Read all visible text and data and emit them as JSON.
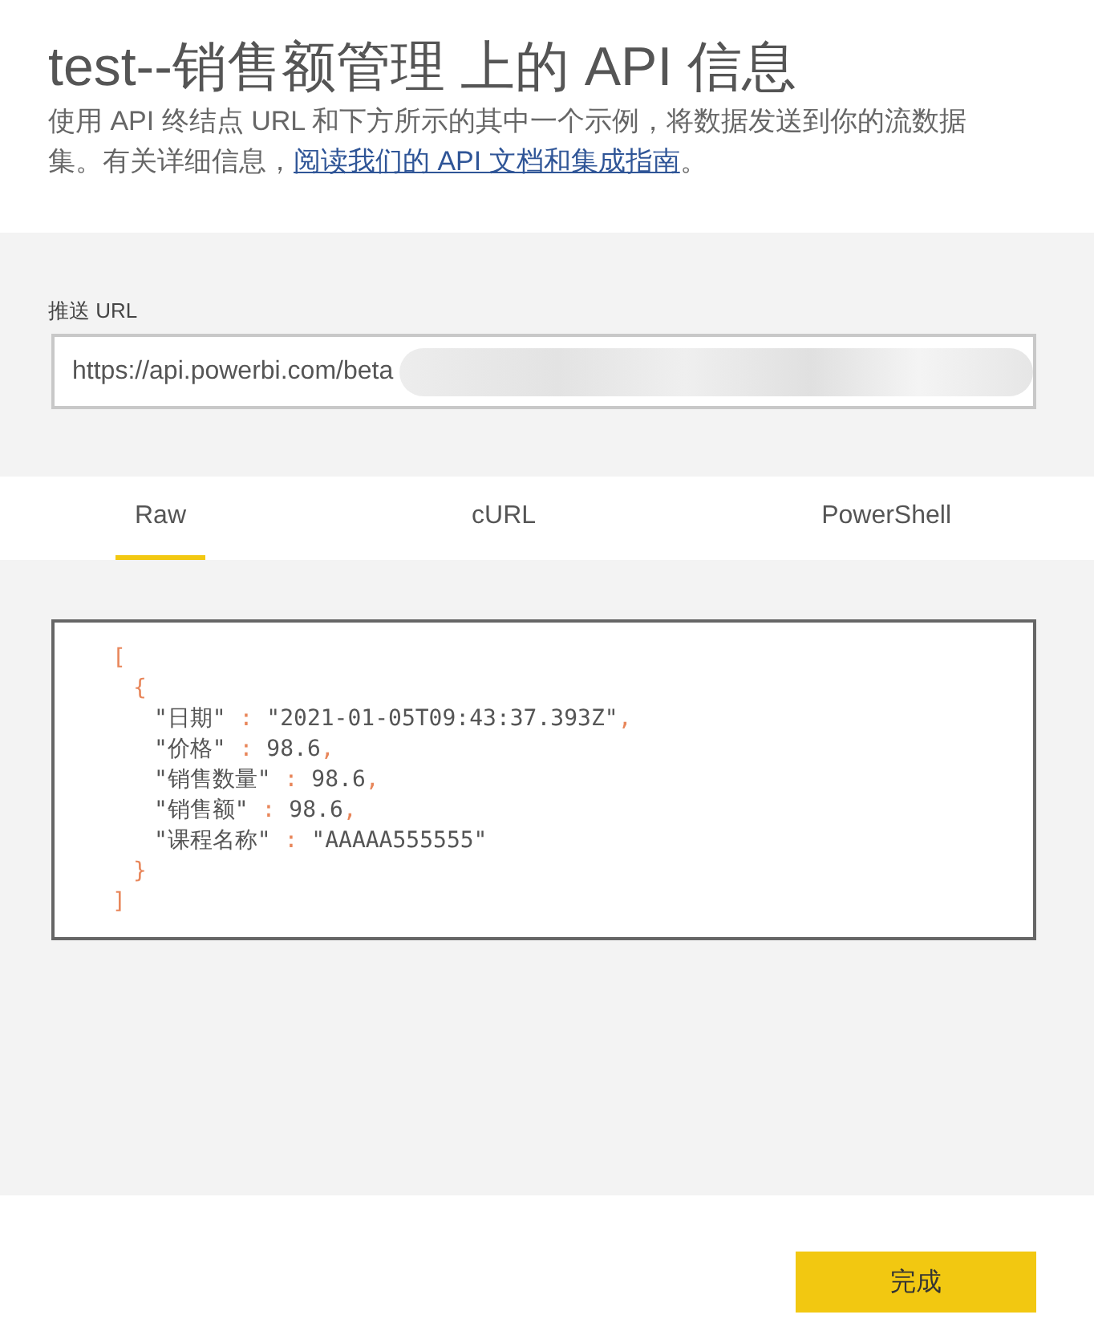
{
  "dialog": {
    "title": "test--销售额管理 上的 API 信息",
    "description": {
      "text": "使用 API 终结点 URL 和下方所示的其中一个示例，将数据发送到你的流数据集。有关详细信息，",
      "link": "阅读我们的 API 文档和集成指南",
      "after": "。"
    }
  },
  "push_url": {
    "label": "推送 URL",
    "value": "https://api.powerbi.com/beta",
    "redacted": true
  },
  "tabs": [
    {
      "label": "Raw",
      "selected": true
    },
    {
      "label": "cURL",
      "selected": false
    },
    {
      "label": "PowerShell",
      "selected": false
    }
  ],
  "code_sample": [
    {
      "tokens": [
        {
          "kind": "punct",
          "text": "["
        }
      ],
      "children": [
        {
          "tokens": [
            {
              "kind": "punct",
              "text": "{"
            }
          ],
          "children": [
            {
              "tokens": [
                {
                  "kind": "plain",
                  "text": "\"日期\""
                },
                {
                  "kind": "punct",
                  "text": " : "
                },
                {
                  "kind": "plain",
                  "text": "\"2021-01-05T09:43:37.393Z\""
                },
                {
                  "kind": "punct",
                  "text": ","
                }
              ]
            },
            {
              "tokens": [
                {
                  "kind": "plain",
                  "text": "\"价格\""
                },
                {
                  "kind": "punct",
                  "text": " : "
                },
                {
                  "kind": "plain",
                  "text": "98.6"
                },
                {
                  "kind": "punct",
                  "text": ","
                }
              ]
            },
            {
              "tokens": [
                {
                  "kind": "plain",
                  "text": "\"销售数量\""
                },
                {
                  "kind": "punct",
                  "text": " : "
                },
                {
                  "kind": "plain",
                  "text": "98.6"
                },
                {
                  "kind": "punct",
                  "text": ","
                }
              ]
            },
            {
              "tokens": [
                {
                  "kind": "plain",
                  "text": "\"销售额\""
                },
                {
                  "kind": "punct",
                  "text": " : "
                },
                {
                  "kind": "plain",
                  "text": "98.6"
                },
                {
                  "kind": "punct",
                  "text": ","
                }
              ]
            },
            {
              "tokens": [
                {
                  "kind": "plain",
                  "text": "\"课程名称\""
                },
                {
                  "kind": "punct",
                  "text": " : "
                },
                {
                  "kind": "plain",
                  "text": "\"AAAAA555555\""
                }
              ]
            }
          ]
        },
        {
          "tokens": [
            {
              "kind": "punct",
              "text": "}"
            }
          ]
        }
      ]
    },
    {
      "tokens": [
        {
          "kind": "punct",
          "text": "]"
        }
      ]
    }
  ],
  "footer": {
    "button": "完成"
  }
}
